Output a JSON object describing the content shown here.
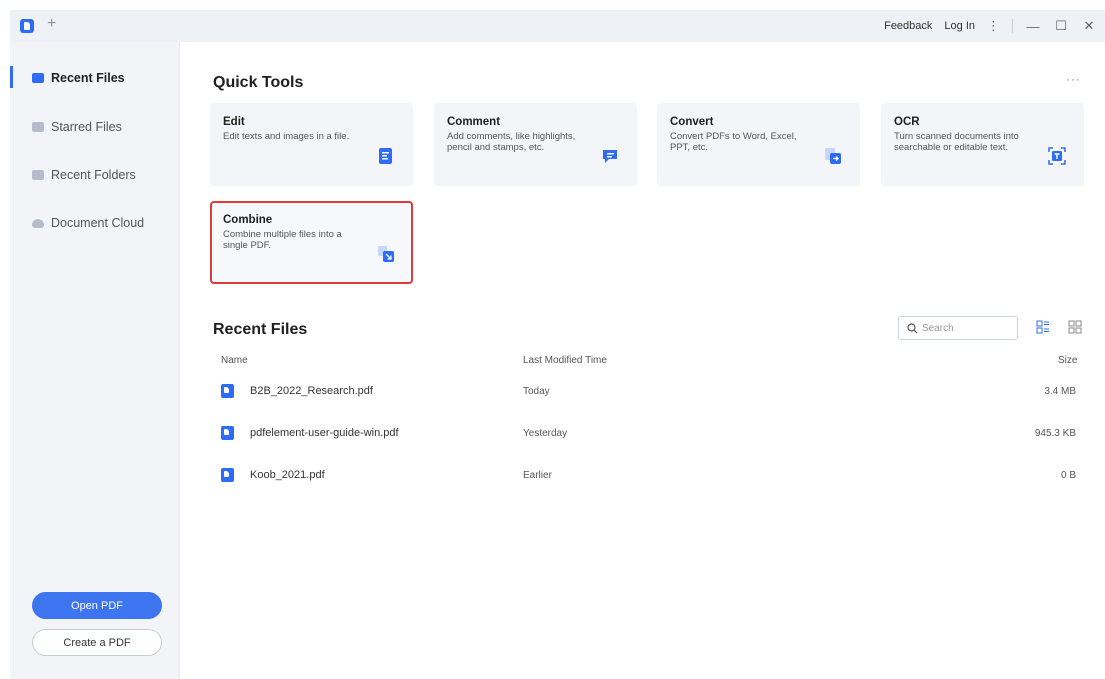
{
  "titlebar": {
    "new_tab": "+",
    "feedback": "Feedback",
    "login": "Log In",
    "menu": "⋮",
    "minimize": "—",
    "maximize": "☐",
    "close": "✕"
  },
  "sidebar": {
    "items": [
      {
        "label": "Recent Files",
        "icon": "recent-files-icon",
        "active": true
      },
      {
        "label": "Starred Files",
        "icon": "star-icon",
        "active": false
      },
      {
        "label": "Recent Folders",
        "icon": "folder-icon",
        "active": false
      },
      {
        "label": "Document Cloud",
        "icon": "cloud-icon",
        "active": false
      }
    ],
    "open_pdf": "Open PDF",
    "create_pdf": "Create a PDF"
  },
  "quick_tools": {
    "title": "Quick Tools",
    "more": "···",
    "cards": [
      {
        "title": "Edit",
        "desc": "Edit texts and images in a file.",
        "icon": "edit-icon"
      },
      {
        "title": "Comment",
        "desc": "Add comments, like highlights, pencil and stamps, etc.",
        "icon": "comment-icon"
      },
      {
        "title": "Convert",
        "desc": "Convert PDFs to Word, Excel, PPT, etc.",
        "icon": "convert-icon"
      },
      {
        "title": "OCR",
        "desc": "Turn scanned documents into searchable or editable text.",
        "icon": "ocr-icon"
      },
      {
        "title": "Combine",
        "desc": "Combine multiple files into a single PDF.",
        "icon": "combine-icon"
      }
    ]
  },
  "recent": {
    "title": "Recent Files",
    "search_placeholder": "Search",
    "columns": {
      "name": "Name",
      "modified": "Last Modified Time",
      "size": "Size"
    },
    "files": [
      {
        "name": "B2B_2022_Research.pdf",
        "modified": "Today",
        "size": "3.4 MB"
      },
      {
        "name": "pdfelement-user-guide-win.pdf",
        "modified": "Yesterday",
        "size": "945.3 KB"
      },
      {
        "name": "Koob_2021.pdf",
        "modified": "Earlier",
        "size": "0 B"
      }
    ]
  },
  "colors": {
    "accent": "#2f6cf5",
    "highlight_border": "#e03a3a",
    "sidebar_bg": "#f2f4f8",
    "card_bg": "#f3f5f9"
  }
}
